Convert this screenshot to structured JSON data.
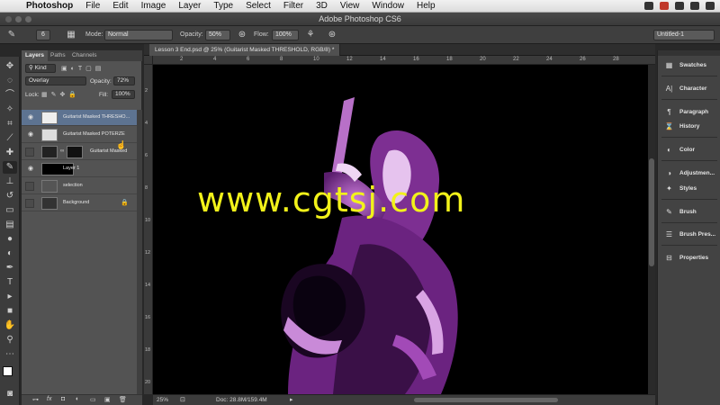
{
  "menubar": {
    "app": "Photoshop",
    "items": [
      "File",
      "Edit",
      "Image",
      "Layer",
      "Type",
      "Select",
      "Filter",
      "3D",
      "View",
      "Window",
      "Help"
    ]
  },
  "window": {
    "title": "Adobe Photoshop CS6"
  },
  "options": {
    "brush_size": "6",
    "mode_label": "Mode:",
    "mode_value": "Normal",
    "opacity_label": "Opacity:",
    "opacity_value": "50%",
    "flow_label": "Flow:",
    "flow_value": "100%",
    "workspace": "Untitled-1"
  },
  "layers_panel": {
    "tabs": [
      "Layers",
      "Paths",
      "Channels"
    ],
    "filter_kind": "Kind",
    "blend_mode": "Overlay",
    "opacity_label": "Opacity:",
    "opacity_value": "72%",
    "lock_label": "Lock:",
    "fill_label": "Fill:",
    "fill_value": "100%",
    "layers": [
      {
        "name": "Guitarist Masked THRESHO..."
      },
      {
        "name": "Guitarist Masked POTERZE"
      },
      {
        "name": "Guitarist Masked"
      },
      {
        "name": "Layer 1"
      },
      {
        "name": "selection"
      },
      {
        "name": "Background"
      }
    ]
  },
  "document": {
    "tab_title": "Lesson 3 End.psd @ 25% (Guitarist Masked THRESHOLD, RGB/8) *",
    "zoom": "25%",
    "doc_size": "Doc: 28.8M/159.4M",
    "ruler_h": [
      "2",
      "4",
      "6",
      "8",
      "10",
      "12",
      "14",
      "16",
      "18",
      "20",
      "22",
      "24",
      "26",
      "28"
    ],
    "ruler_v": [
      "2",
      "4",
      "6",
      "8",
      "10",
      "12",
      "14",
      "16",
      "18",
      "20"
    ]
  },
  "watermark": "www.cgtsj.com",
  "right_dock": {
    "items": [
      "Swatches",
      "Character",
      "Paragraph",
      "History",
      "Color",
      "Adjustmen...",
      "Styles",
      "Brush",
      "Brush Pres...",
      "Properties"
    ]
  },
  "colors": {
    "accent_purple": "#a24ab7",
    "watermark": "#f2f21a",
    "active_layer": "#5d7391"
  }
}
